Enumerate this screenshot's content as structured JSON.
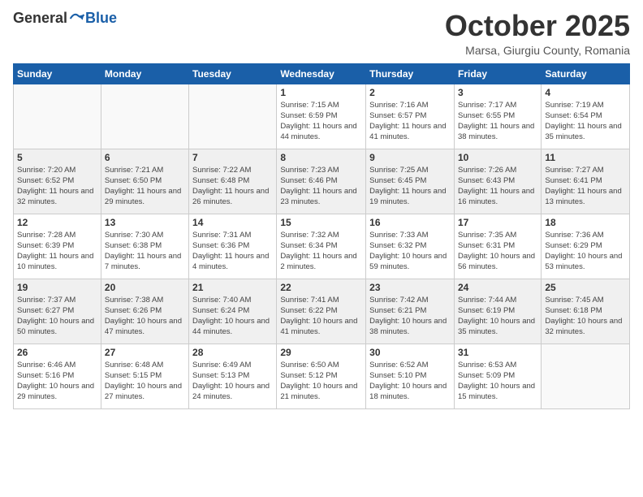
{
  "header": {
    "logo_general": "General",
    "logo_blue": "Blue",
    "month_title": "October 2025",
    "subtitle": "Marsa, Giurgiu County, Romania"
  },
  "days_of_week": [
    "Sunday",
    "Monday",
    "Tuesday",
    "Wednesday",
    "Thursday",
    "Friday",
    "Saturday"
  ],
  "weeks": [
    [
      {
        "day": "",
        "sunrise": "",
        "sunset": "",
        "daylight": ""
      },
      {
        "day": "",
        "sunrise": "",
        "sunset": "",
        "daylight": ""
      },
      {
        "day": "",
        "sunrise": "",
        "sunset": "",
        "daylight": ""
      },
      {
        "day": "1",
        "sunrise": "Sunrise: 7:15 AM",
        "sunset": "Sunset: 6:59 PM",
        "daylight": "Daylight: 11 hours and 44 minutes."
      },
      {
        "day": "2",
        "sunrise": "Sunrise: 7:16 AM",
        "sunset": "Sunset: 6:57 PM",
        "daylight": "Daylight: 11 hours and 41 minutes."
      },
      {
        "day": "3",
        "sunrise": "Sunrise: 7:17 AM",
        "sunset": "Sunset: 6:55 PM",
        "daylight": "Daylight: 11 hours and 38 minutes."
      },
      {
        "day": "4",
        "sunrise": "Sunrise: 7:19 AM",
        "sunset": "Sunset: 6:54 PM",
        "daylight": "Daylight: 11 hours and 35 minutes."
      }
    ],
    [
      {
        "day": "5",
        "sunrise": "Sunrise: 7:20 AM",
        "sunset": "Sunset: 6:52 PM",
        "daylight": "Daylight: 11 hours and 32 minutes."
      },
      {
        "day": "6",
        "sunrise": "Sunrise: 7:21 AM",
        "sunset": "Sunset: 6:50 PM",
        "daylight": "Daylight: 11 hours and 29 minutes."
      },
      {
        "day": "7",
        "sunrise": "Sunrise: 7:22 AM",
        "sunset": "Sunset: 6:48 PM",
        "daylight": "Daylight: 11 hours and 26 minutes."
      },
      {
        "day": "8",
        "sunrise": "Sunrise: 7:23 AM",
        "sunset": "Sunset: 6:46 PM",
        "daylight": "Daylight: 11 hours and 23 minutes."
      },
      {
        "day": "9",
        "sunrise": "Sunrise: 7:25 AM",
        "sunset": "Sunset: 6:45 PM",
        "daylight": "Daylight: 11 hours and 19 minutes."
      },
      {
        "day": "10",
        "sunrise": "Sunrise: 7:26 AM",
        "sunset": "Sunset: 6:43 PM",
        "daylight": "Daylight: 11 hours and 16 minutes."
      },
      {
        "day": "11",
        "sunrise": "Sunrise: 7:27 AM",
        "sunset": "Sunset: 6:41 PM",
        "daylight": "Daylight: 11 hours and 13 minutes."
      }
    ],
    [
      {
        "day": "12",
        "sunrise": "Sunrise: 7:28 AM",
        "sunset": "Sunset: 6:39 PM",
        "daylight": "Daylight: 11 hours and 10 minutes."
      },
      {
        "day": "13",
        "sunrise": "Sunrise: 7:30 AM",
        "sunset": "Sunset: 6:38 PM",
        "daylight": "Daylight: 11 hours and 7 minutes."
      },
      {
        "day": "14",
        "sunrise": "Sunrise: 7:31 AM",
        "sunset": "Sunset: 6:36 PM",
        "daylight": "Daylight: 11 hours and 4 minutes."
      },
      {
        "day": "15",
        "sunrise": "Sunrise: 7:32 AM",
        "sunset": "Sunset: 6:34 PM",
        "daylight": "Daylight: 11 hours and 2 minutes."
      },
      {
        "day": "16",
        "sunrise": "Sunrise: 7:33 AM",
        "sunset": "Sunset: 6:32 PM",
        "daylight": "Daylight: 10 hours and 59 minutes."
      },
      {
        "day": "17",
        "sunrise": "Sunrise: 7:35 AM",
        "sunset": "Sunset: 6:31 PM",
        "daylight": "Daylight: 10 hours and 56 minutes."
      },
      {
        "day": "18",
        "sunrise": "Sunrise: 7:36 AM",
        "sunset": "Sunset: 6:29 PM",
        "daylight": "Daylight: 10 hours and 53 minutes."
      }
    ],
    [
      {
        "day": "19",
        "sunrise": "Sunrise: 7:37 AM",
        "sunset": "Sunset: 6:27 PM",
        "daylight": "Daylight: 10 hours and 50 minutes."
      },
      {
        "day": "20",
        "sunrise": "Sunrise: 7:38 AM",
        "sunset": "Sunset: 6:26 PM",
        "daylight": "Daylight: 10 hours and 47 minutes."
      },
      {
        "day": "21",
        "sunrise": "Sunrise: 7:40 AM",
        "sunset": "Sunset: 6:24 PM",
        "daylight": "Daylight: 10 hours and 44 minutes."
      },
      {
        "day": "22",
        "sunrise": "Sunrise: 7:41 AM",
        "sunset": "Sunset: 6:22 PM",
        "daylight": "Daylight: 10 hours and 41 minutes."
      },
      {
        "day": "23",
        "sunrise": "Sunrise: 7:42 AM",
        "sunset": "Sunset: 6:21 PM",
        "daylight": "Daylight: 10 hours and 38 minutes."
      },
      {
        "day": "24",
        "sunrise": "Sunrise: 7:44 AM",
        "sunset": "Sunset: 6:19 PM",
        "daylight": "Daylight: 10 hours and 35 minutes."
      },
      {
        "day": "25",
        "sunrise": "Sunrise: 7:45 AM",
        "sunset": "Sunset: 6:18 PM",
        "daylight": "Daylight: 10 hours and 32 minutes."
      }
    ],
    [
      {
        "day": "26",
        "sunrise": "Sunrise: 6:46 AM",
        "sunset": "Sunset: 5:16 PM",
        "daylight": "Daylight: 10 hours and 29 minutes."
      },
      {
        "day": "27",
        "sunrise": "Sunrise: 6:48 AM",
        "sunset": "Sunset: 5:15 PM",
        "daylight": "Daylight: 10 hours and 27 minutes."
      },
      {
        "day": "28",
        "sunrise": "Sunrise: 6:49 AM",
        "sunset": "Sunset: 5:13 PM",
        "daylight": "Daylight: 10 hours and 24 minutes."
      },
      {
        "day": "29",
        "sunrise": "Sunrise: 6:50 AM",
        "sunset": "Sunset: 5:12 PM",
        "daylight": "Daylight: 10 hours and 21 minutes."
      },
      {
        "day": "30",
        "sunrise": "Sunrise: 6:52 AM",
        "sunset": "Sunset: 5:10 PM",
        "daylight": "Daylight: 10 hours and 18 minutes."
      },
      {
        "day": "31",
        "sunrise": "Sunrise: 6:53 AM",
        "sunset": "Sunset: 5:09 PM",
        "daylight": "Daylight: 10 hours and 15 minutes."
      },
      {
        "day": "",
        "sunrise": "",
        "sunset": "",
        "daylight": ""
      }
    ]
  ]
}
